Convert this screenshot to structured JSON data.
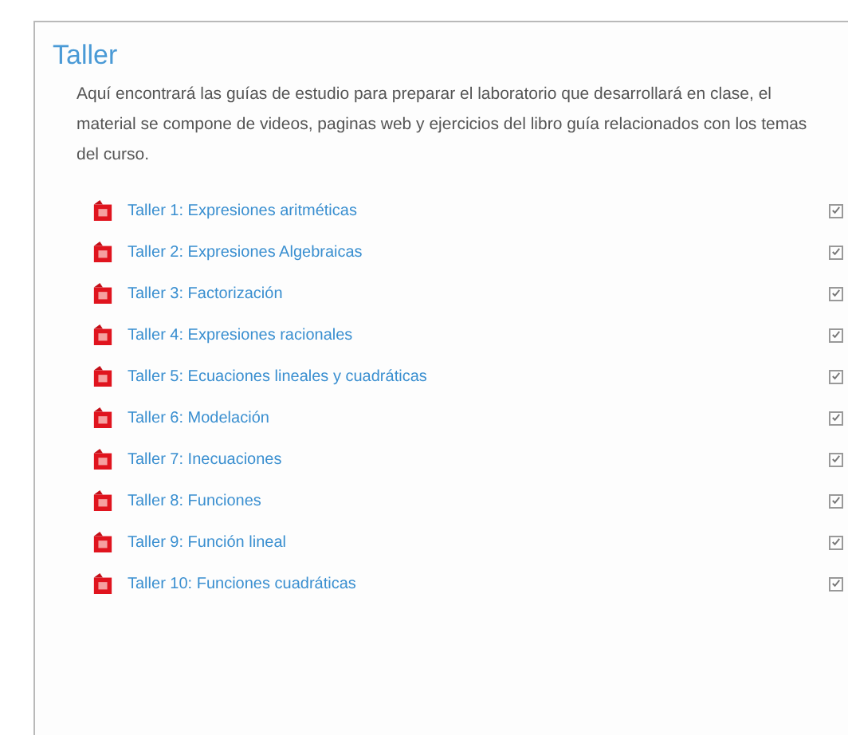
{
  "section": {
    "title": "Taller",
    "description": "Aquí encontrará las guías de estudio para preparar el laboratorio que desarrollará en clase, el material se compone de videos, paginas web y ejercicios del libro guía relacionados con los temas del curso."
  },
  "items": [
    {
      "label": "Taller 1: Expresiones aritméticas",
      "checked": true
    },
    {
      "label": "Taller 2: Expresiones Algebraicas",
      "checked": true
    },
    {
      "label": "Taller 3: Factorización",
      "checked": true
    },
    {
      "label": "Taller 4: Expresiones racionales",
      "checked": true
    },
    {
      "label": "Taller 5: Ecuaciones lineales y cuadráticas",
      "checked": true
    },
    {
      "label": "Taller 6: Modelación",
      "checked": true
    },
    {
      "label": "Taller 7: Inecuaciones",
      "checked": true
    },
    {
      "label": "Taller 8: Funciones",
      "checked": true
    },
    {
      "label": "Taller 9: Función lineal",
      "checked": true
    },
    {
      "label": "Taller 10: Funciones cuadráticas",
      "checked": true
    }
  ]
}
